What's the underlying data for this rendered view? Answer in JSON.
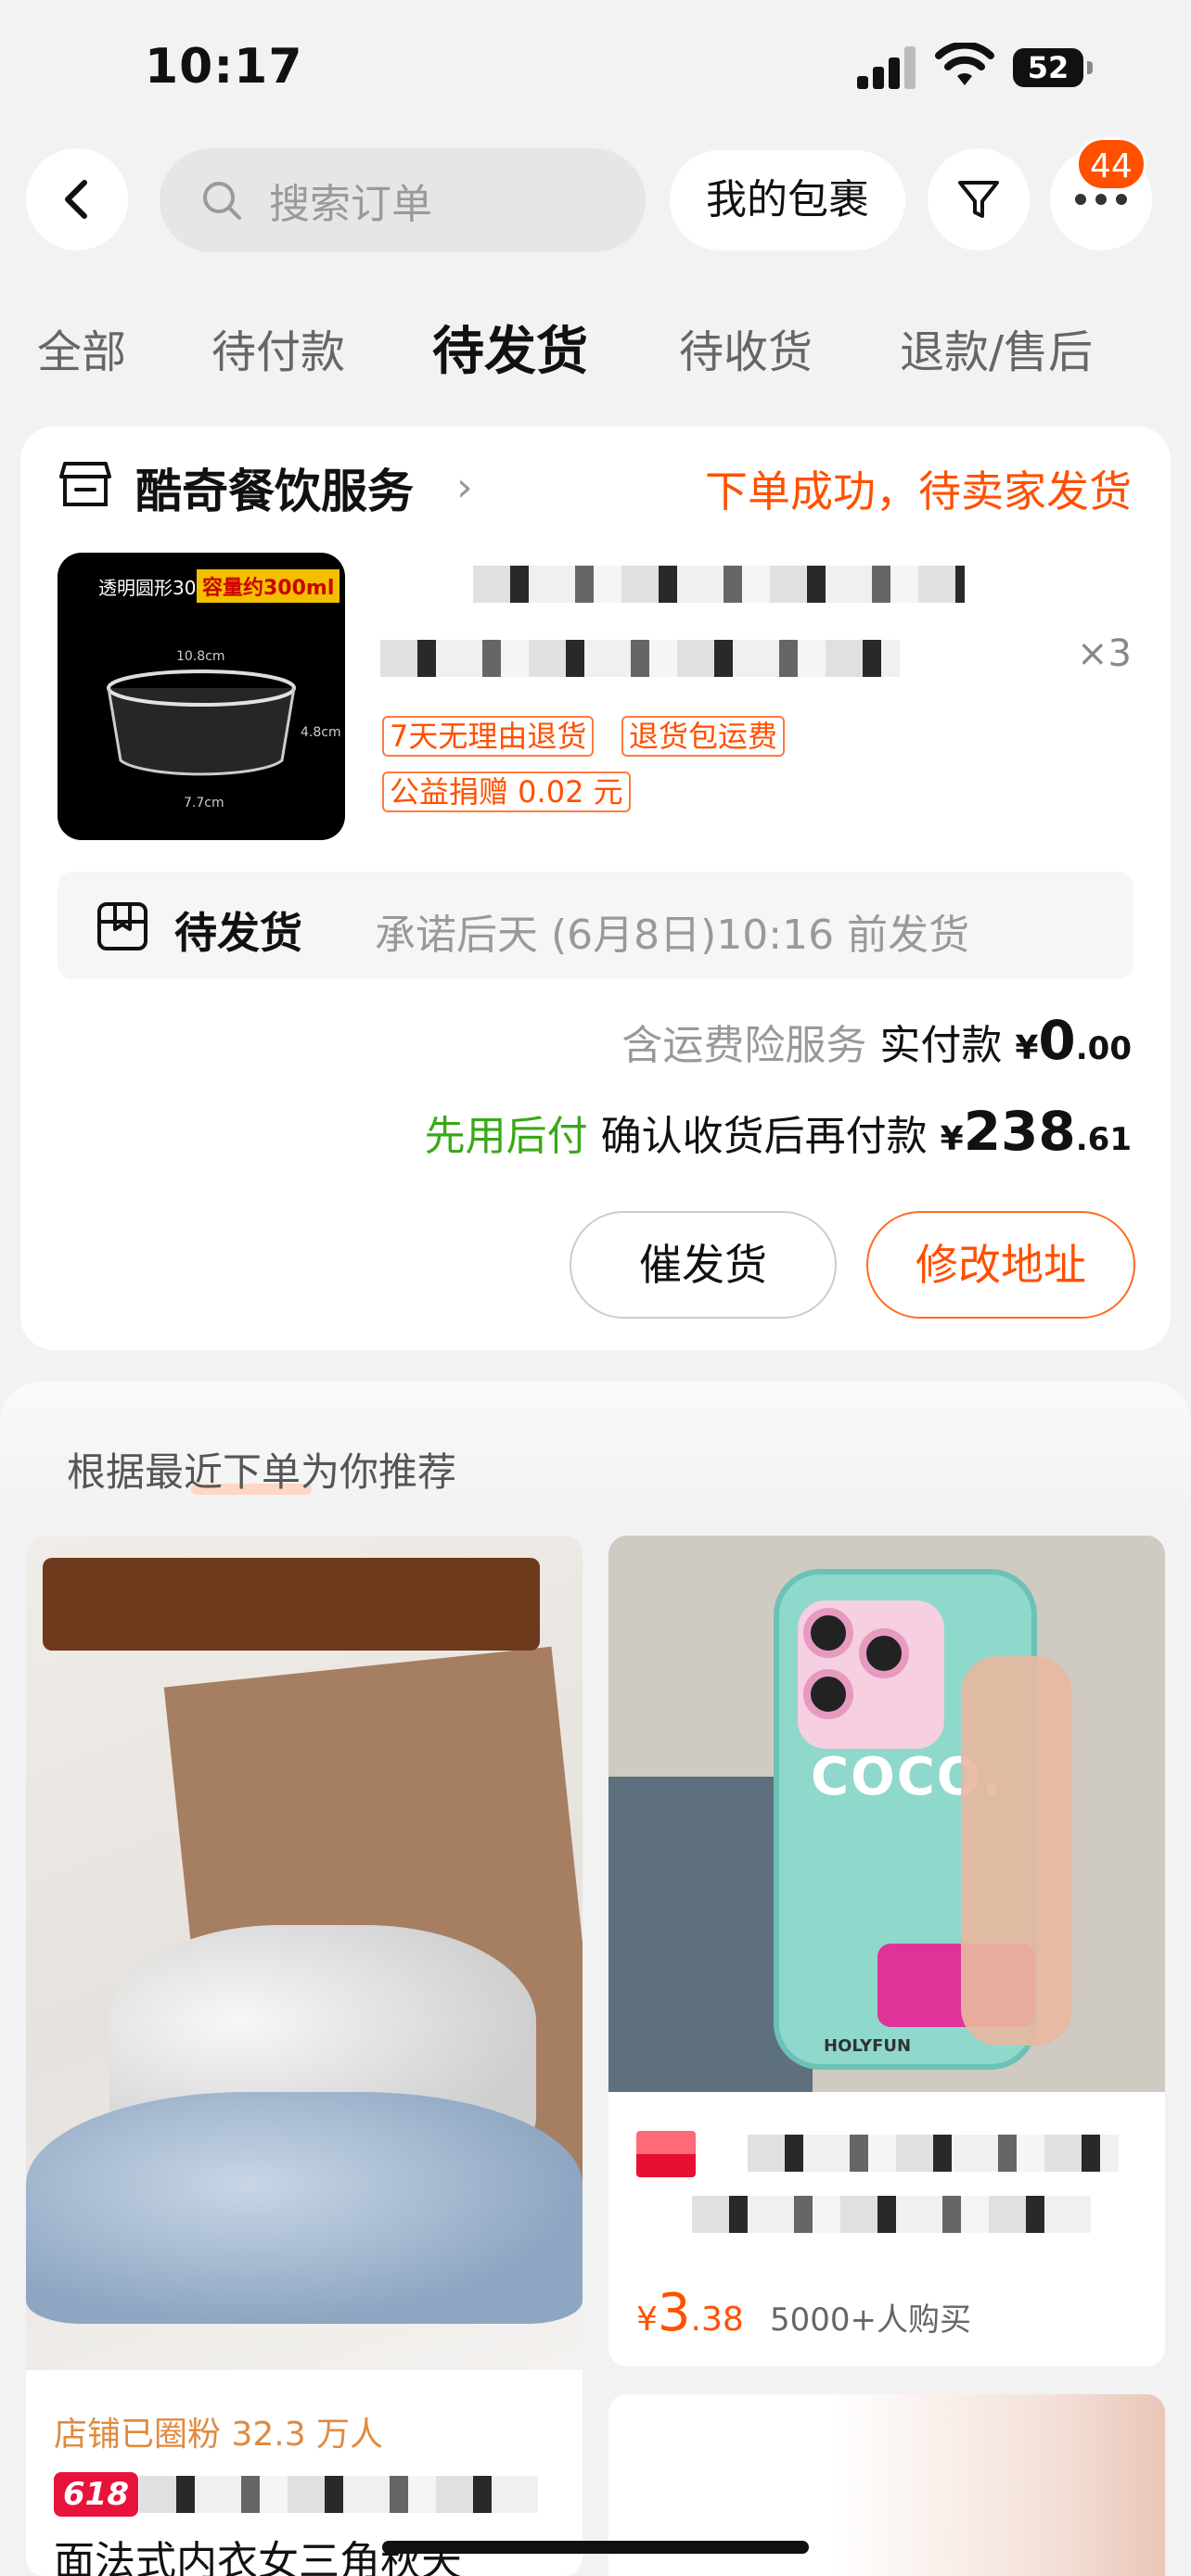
{
  "status_bar": {
    "time": "10:17",
    "battery": "52"
  },
  "nav": {
    "search_placeholder": "搜索订单",
    "my_package": "我的包裹",
    "more_badge": "44"
  },
  "tabs": [
    {
      "label": "全部",
      "active": false
    },
    {
      "label": "待付款",
      "active": false
    },
    {
      "label": "待发货",
      "active": true
    },
    {
      "label": "待收货",
      "active": false
    },
    {
      "label": "退款/售后",
      "active": false
    }
  ],
  "order": {
    "shop_name": "酷奇餐饮服务",
    "status": "下单成功，待卖家发货",
    "thumb_text": {
      "title": "透明圆形300",
      "tag": "容量约300ml",
      "width": "10.8cm",
      "height": "4.8cm",
      "bottom": "7.7cm"
    },
    "quantity": "×3",
    "service_tags": [
      "7天无理由退货",
      "退货包运费",
      "公益捐赠 0.02 元"
    ],
    "shipping": {
      "label": "待发货",
      "promise": "承诺后天 (6月8日)10:16 前发货"
    },
    "freight_insurance": "含运费险服务",
    "paid_label": "实付款",
    "paid_currency": "¥",
    "paid_int": "0",
    "paid_dec": ".00",
    "pay_later": "先用后付",
    "pay_later_desc": "确认收货后再付款",
    "total_currency": "¥",
    "total_int": "238",
    "total_dec": ".61",
    "btn_urge": "催发货",
    "btn_change_address": "修改地址"
  },
  "recommend": {
    "title": "根据最近下单为你推荐",
    "products": [
      {
        "shop_fans": "店铺已圈粉 32.3 万人",
        "badge": "618",
        "title_partial": "面法式内衣女三角秋天"
      },
      {
        "case_text": "COCO.",
        "case_brand": "HOLYFUN",
        "price_currency": "¥",
        "price_int": "3",
        "price_dec": ".38",
        "sold": "5000+人购买"
      }
    ]
  },
  "colors": {
    "accent": "#ff5000",
    "green": "#3aa818"
  }
}
